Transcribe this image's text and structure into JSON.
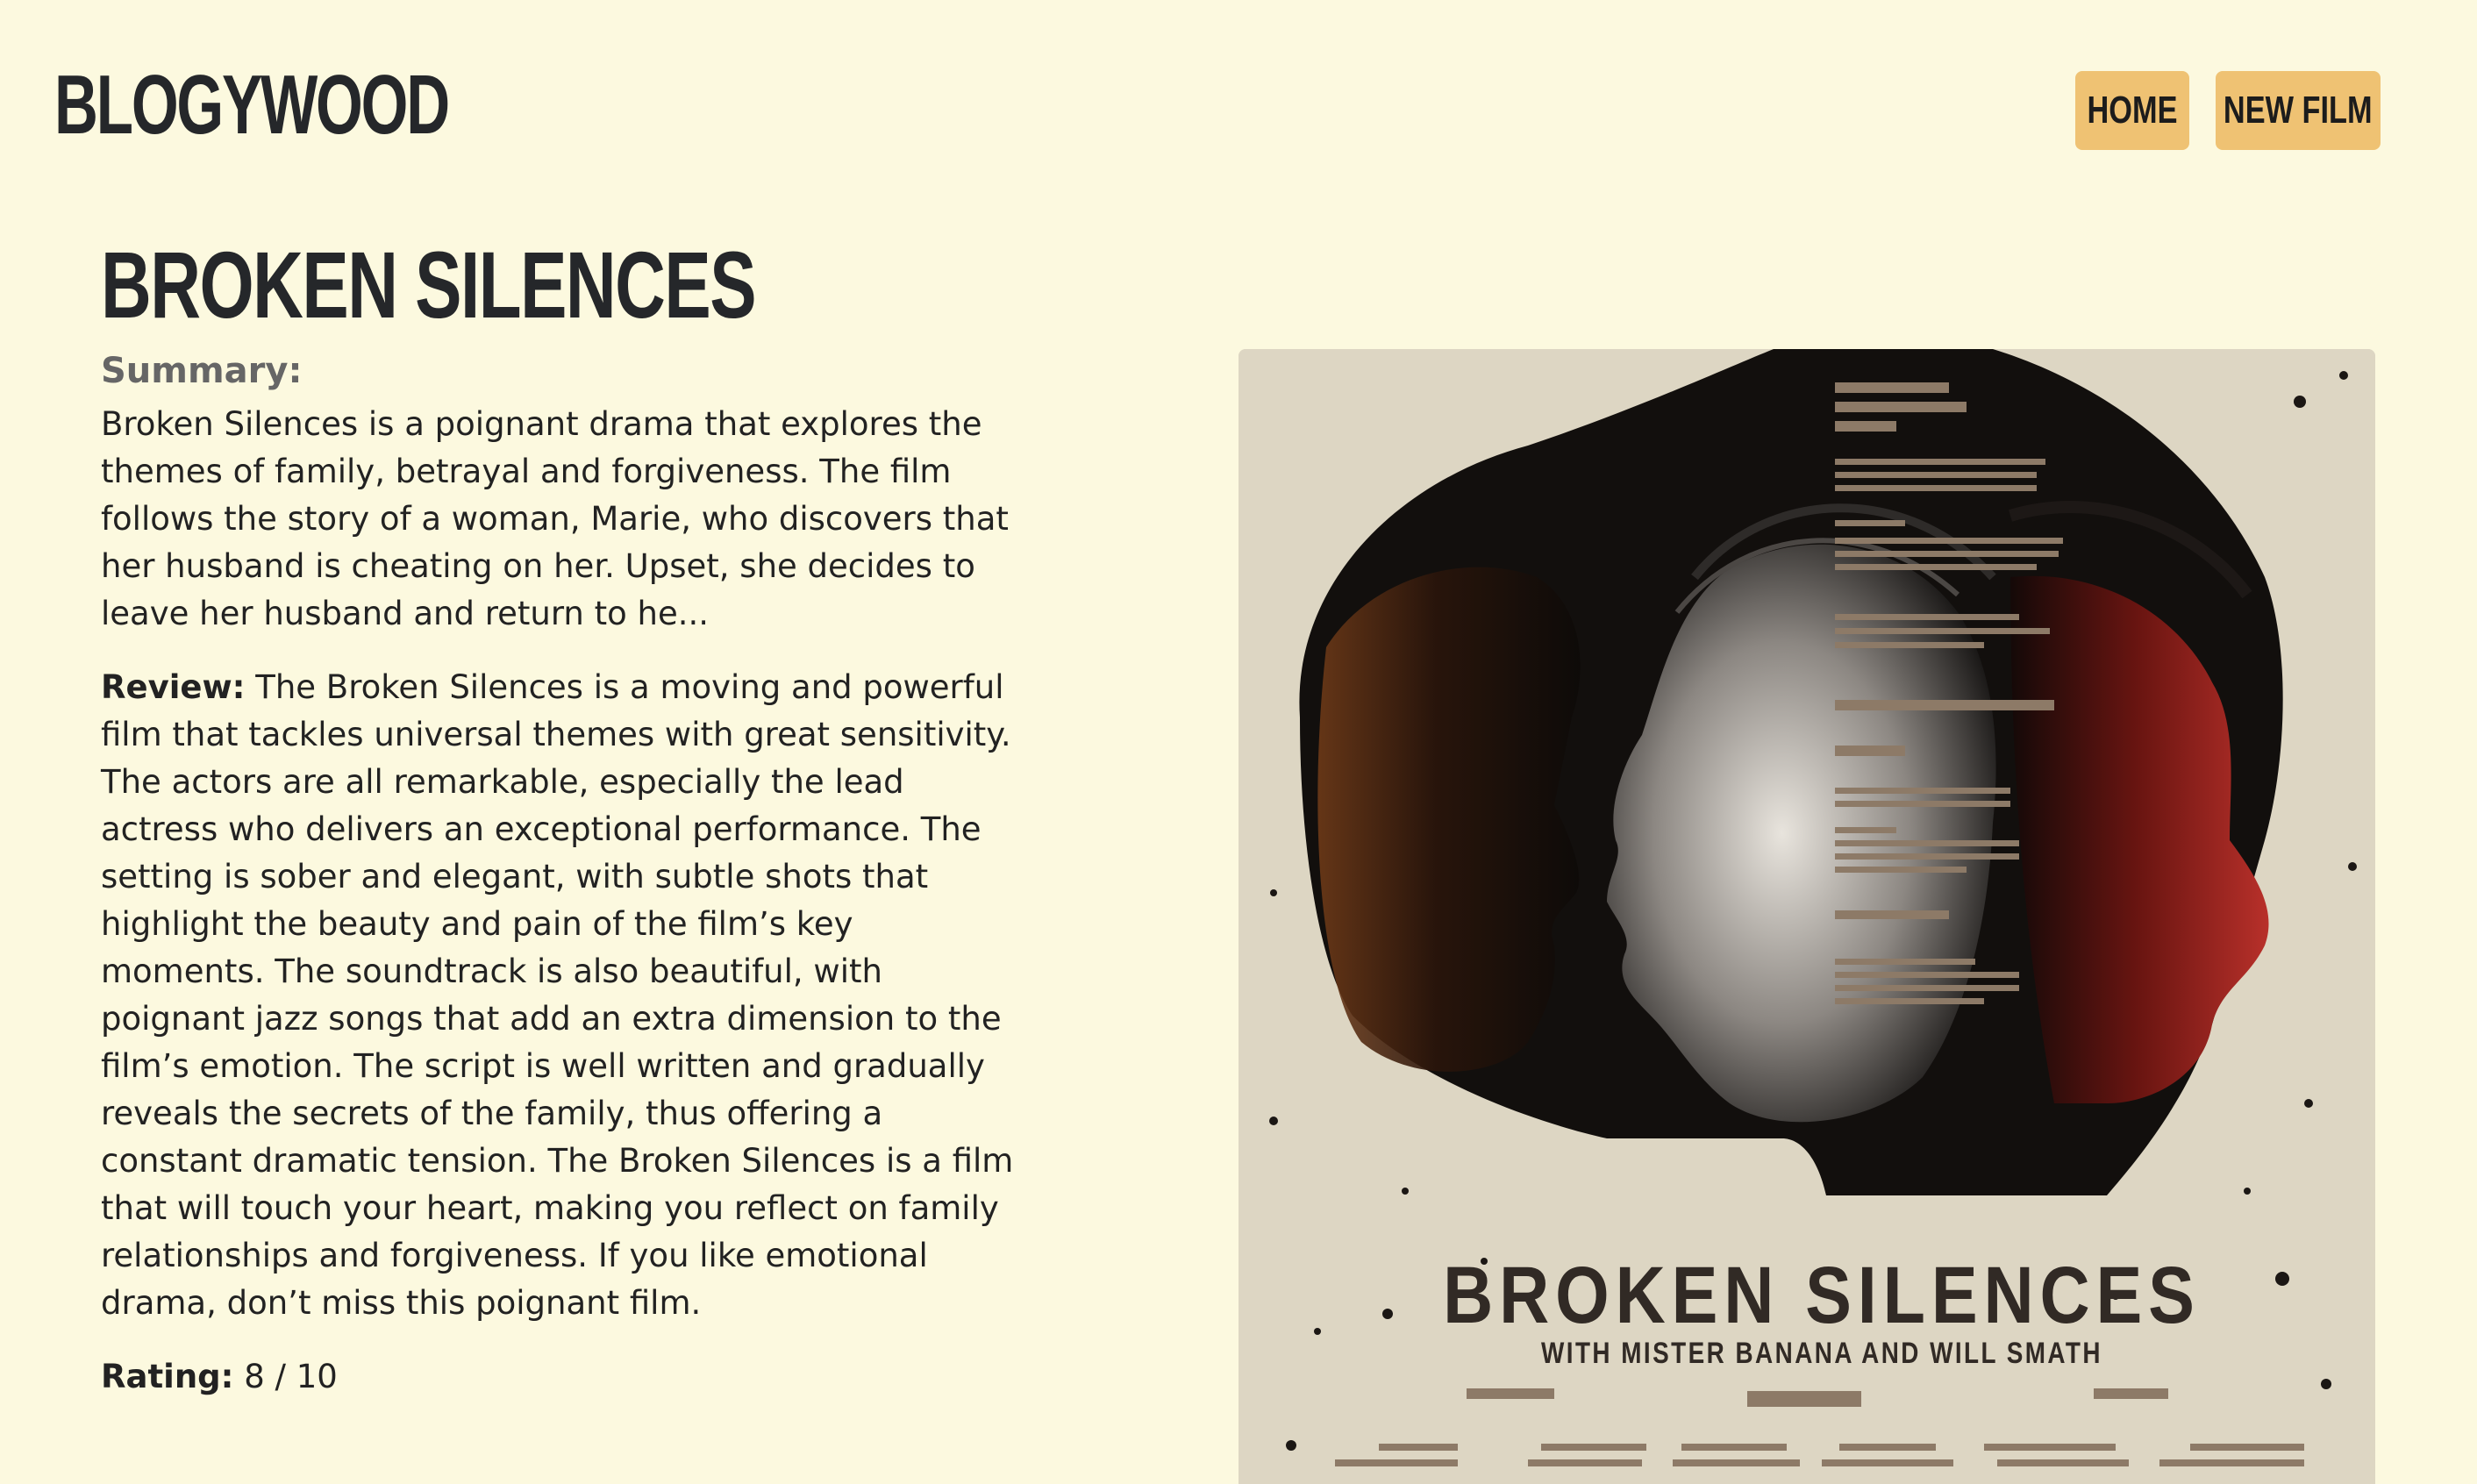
{
  "header": {
    "logo": "BLOGYWOOD",
    "nav": {
      "home_label": "HOME",
      "new_film_label": "NEW FILM"
    }
  },
  "film": {
    "title": "BROKEN SILENCES",
    "summary_label": "Summary:",
    "summary": "Broken Silences is a poignant drama that explores the themes of family, betrayal and forgiveness. The film follows the story of a woman, Marie, who discovers that her husband is cheating on her. Upset, she decides to leave her husband and return to he...",
    "review_label": "Review:",
    "review": "The Broken Silences is a moving and powerful film that tackles universal themes with great sensitivity. The actors are all remarkable, especially the lead actress who delivers an exceptional performance. The setting is sober and elegant, with subtle shots that highlight the beauty and pain of the film’s key moments. The soundtrack is also beautiful, with poignant jazz songs that add an extra dimension to the film’s emotion. The script is well written and gradually reveals the secrets of the family, thus offering a constant dramatic tension. The Broken Silences is a film that will touch your heart, making you reflect on family relationships and forgiveness. If you like emotional drama, don’t miss this poignant film.",
    "rating_label": "Rating:",
    "rating_value": "8 / 10"
  },
  "poster": {
    "title": "BROKEN SILENCES",
    "subtitle": "WITH MISTER BANANA AND WILL SMATH",
    "colors": {
      "paper": "#ddd6c3",
      "ink": "#161310",
      "red": "#a5241c",
      "orange": "#8a4a20"
    }
  }
}
